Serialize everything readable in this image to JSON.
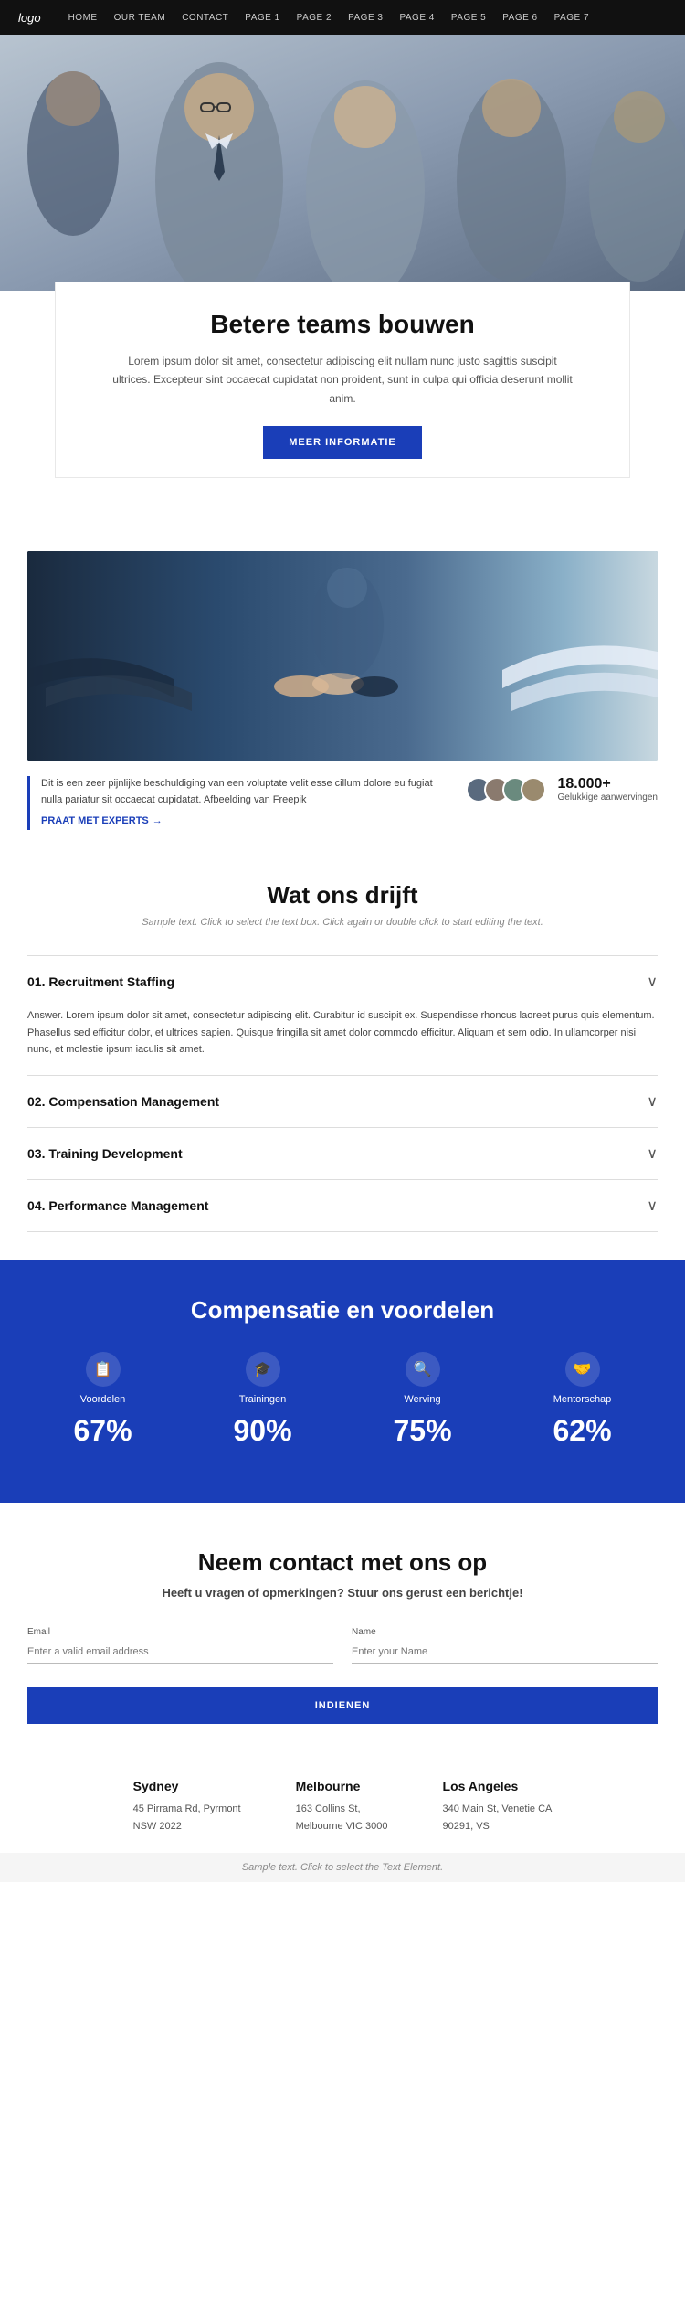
{
  "nav": {
    "logo": "logo",
    "links": [
      "HOME",
      "OUR TEAM",
      "CONTACT",
      "PAGE 1",
      "PAGE 2",
      "PAGE 3",
      "PAGE 4",
      "PAGE 5",
      "PAGE 6",
      "PAGE 7"
    ]
  },
  "hero": {
    "title": "Betere teams bouwen",
    "description": "Lorem ipsum dolor sit amet, consectetur adipiscing elit nullam nunc justo sagittis suscipit ultrices. Excepteur sint occaecat cupidatat non proident, sunt in culpa qui officia deserunt mollit anim.",
    "button": "MEER INFORMATIE"
  },
  "stats": {
    "text": "Dit is een zeer pijnlijke beschuldiging van een voluptate velit esse cillum dolore eu fugiat nulla pariatur sit occaecat cupidatat. Afbeelding van Freepik",
    "link": "PRAAT MET EXPERTS",
    "count": "18.000+",
    "count_label": "Gelukkige aanwervingen"
  },
  "section_drijft": {
    "title": "Wat ons drijft",
    "subtitle": "Sample text. Click to select the text box. Click again or double click to start editing the text."
  },
  "accordion": [
    {
      "number": "01.",
      "title": "Recruitment Staffing",
      "open": true,
      "content": "Answer. Lorem ipsum dolor sit amet, consectetur adipiscing elit. Curabitur id suscipit ex. Suspendisse rhoncus laoreet purus quis elementum. Phasellus sed efficitur dolor, et ultrices sapien. Quisque fringilla sit amet dolor commodo efficitur. Aliquam et sem odio. In ullamcorper nisi nunc, et molestie ipsum iaculis sit amet."
    },
    {
      "number": "02.",
      "title": "Compensation Management",
      "open": false,
      "content": ""
    },
    {
      "number": "03.",
      "title": "Training Development",
      "open": false,
      "content": ""
    },
    {
      "number": "04.",
      "title": "Performance Management",
      "open": false,
      "content": ""
    }
  ],
  "comp_section": {
    "title": "Compensatie en voordelen",
    "items": [
      {
        "icon": "📋",
        "label": "Voordelen",
        "percent": "67%"
      },
      {
        "icon": "🎓",
        "label": "Trainingen",
        "percent": "90%"
      },
      {
        "icon": "🔍",
        "label": "Werving",
        "percent": "75%"
      },
      {
        "icon": "🤝",
        "label": "Mentorschap",
        "percent": "62%"
      }
    ]
  },
  "contact": {
    "title": "Neem contact met ons op",
    "subtitle": "Heeft u vragen of opmerkingen? Stuur ons gerust een berichtje!",
    "email_label": "Email",
    "email_placeholder": "Enter a valid email address",
    "name_label": "Name",
    "name_placeholder": "Enter your Name",
    "button": "INDIENEN"
  },
  "offices": [
    {
      "city": "Sydney",
      "line1": "45 Pirrama Rd, Pyrmont",
      "line2": "NSW 2022"
    },
    {
      "city": "Melbourne",
      "line1": "163 Collins St,",
      "line2": "Melbourne VIC 3000"
    },
    {
      "city": "Los Angeles",
      "line1": "340 Main St, Venetie CA",
      "line2": "90291, VS"
    }
  ],
  "footer": {
    "text": "Sample text. Click to select the Text Element."
  }
}
